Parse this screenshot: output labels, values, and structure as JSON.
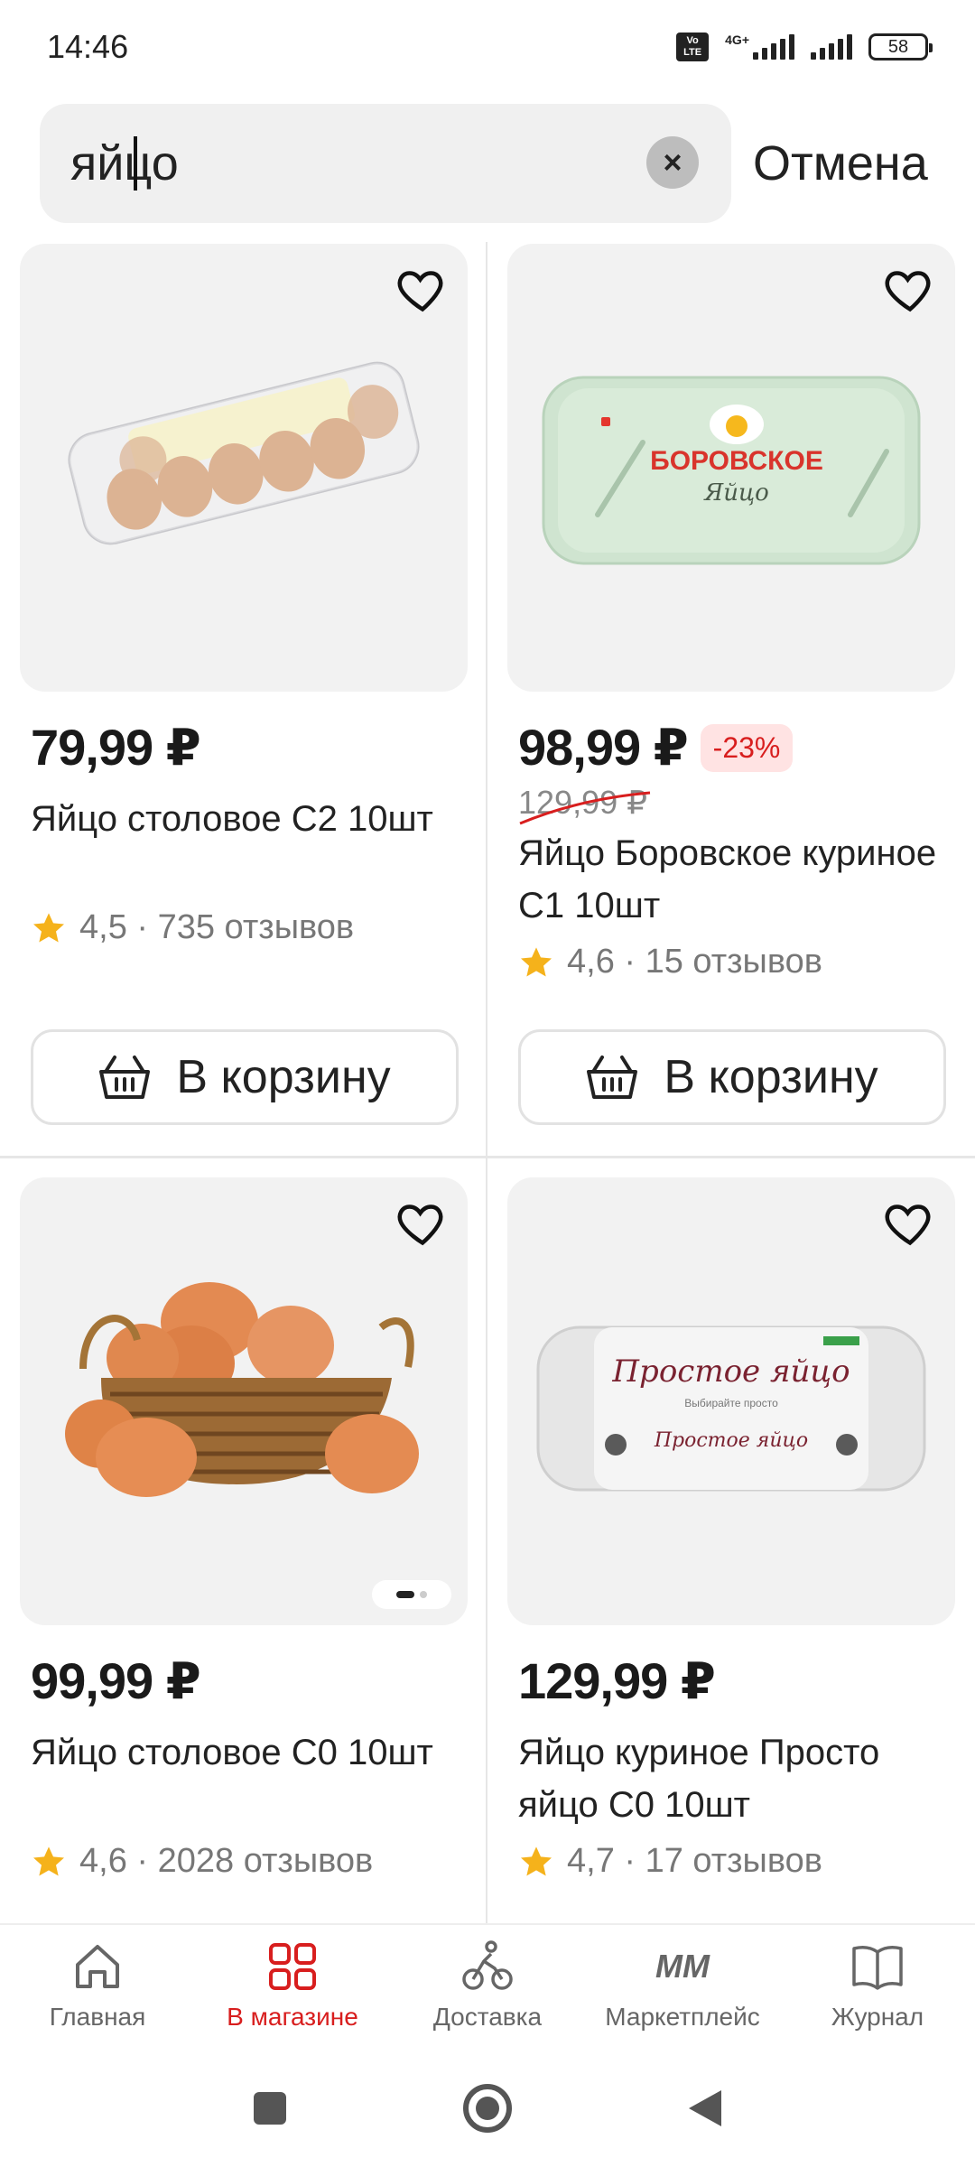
{
  "status": {
    "time": "14:46",
    "volte": "Vo LTE",
    "network": "4G+",
    "battery": "58"
  },
  "search": {
    "query": "яйцо",
    "cancel_label": "Отмена"
  },
  "products": [
    {
      "price": "79,99 ₽",
      "title": "Яйцо столовое С2 10шт",
      "rating": "4,5",
      "reviews": "· 735 отзывов",
      "cart_label": "В корзину"
    },
    {
      "price": "98,99 ₽",
      "discount": "-23%",
      "old_price": "129,99 ₽",
      "title": "Яйцо Боровское куриное С1 10шт",
      "rating": "4,6",
      "reviews": "· 15 отзывов",
      "cart_label": "В корзину",
      "package_brand": "БОРОВСКОЕ",
      "package_sub": "Яйцо"
    },
    {
      "price": "99,99 ₽",
      "title": "Яйцо столовое С0 10шт",
      "rating": "4,6",
      "reviews": "· 2028 отзывов"
    },
    {
      "price": "129,99 ₽",
      "title": "Яйцо куриное Просто яйцо С0 10шт",
      "rating": "4,7",
      "reviews": "· 17 отзывов",
      "package_brand": "Простое яйцо",
      "package_tagline": "Выбирайте просто"
    }
  ],
  "bottom_nav": [
    {
      "label": "Главная",
      "icon": "home-icon"
    },
    {
      "label": "В магазине",
      "icon": "grid-icon",
      "active": true
    },
    {
      "label": "Доставка",
      "icon": "courier-icon"
    },
    {
      "label": "Маркетплейс",
      "icon": "mm-logo-icon",
      "logo_text": "ММ"
    },
    {
      "label": "Журнал",
      "icon": "book-icon"
    }
  ],
  "colors": {
    "accent": "#d81e1e",
    "star": "#f5b21b",
    "card_bg": "#f2f2f2"
  }
}
